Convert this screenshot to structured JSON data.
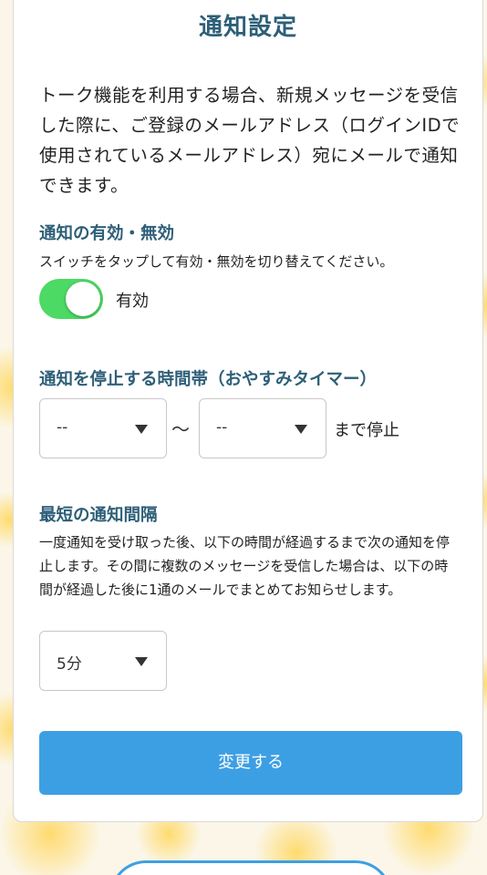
{
  "page": {
    "title": "通知設定",
    "intro": "トーク機能を利用する場合、新規メッセージを受信した際に、ご登録のメールアドレス（ログインIDで使用されているメールアドレス）宛にメールで通知できます。"
  },
  "notification": {
    "heading": "通知の有効・無効",
    "description": "スイッチをタップして有効・無効を切り替えてください。",
    "toggle_on": true,
    "toggle_label": "有効",
    "toggle_color": "#4cd964"
  },
  "timer": {
    "heading": "通知を停止する時間帯（おやすみタイマー）",
    "start_value": "--",
    "separator": "〜",
    "end_value": "--",
    "suffix": "まで停止"
  },
  "interval": {
    "heading": "最短の通知間隔",
    "description": "一度通知を受け取った後、以下の時間が経過するまで次の通知を停止します。その間に複数のメッセージを受信した場合は、以下の時間が経過した後に1通のメールでまとめてお知らせします。",
    "value": "5分"
  },
  "actions": {
    "submit_label": "変更する",
    "submit_color": "#3d9fe3"
  },
  "theme": {
    "heading_color": "#2e5f78"
  }
}
